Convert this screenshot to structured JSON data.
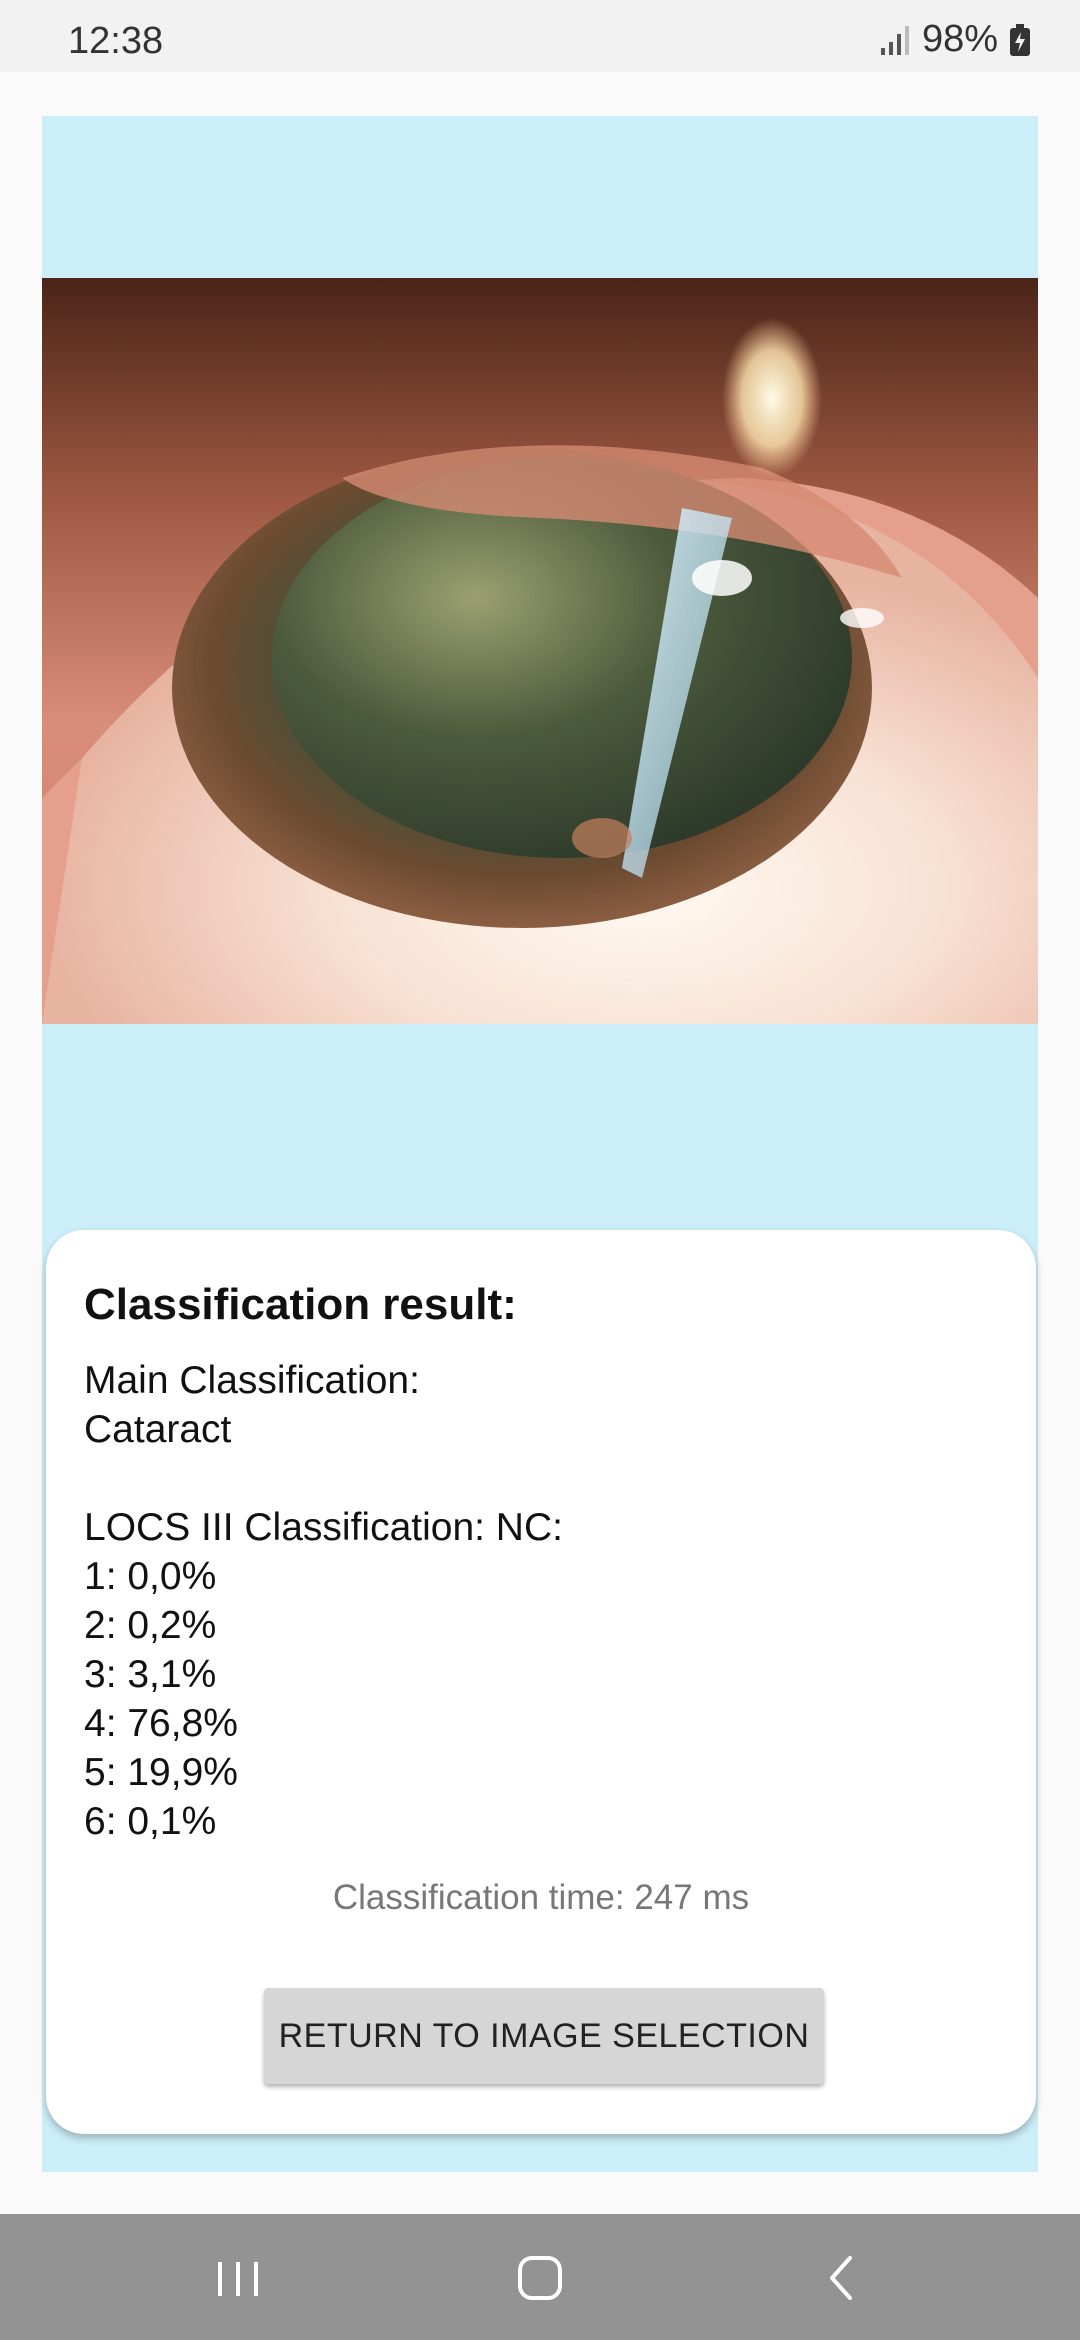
{
  "status_bar": {
    "time": "12:38",
    "battery": "98%",
    "signal_icon": "signal-icon",
    "battery_icon": "battery-charging-icon"
  },
  "colors": {
    "panel_background": "#cbeef8",
    "card_background": "#ffffff",
    "button_background": "#d6d6d6",
    "nav_bar": "#939393"
  },
  "image": {
    "subject": "eye photograph"
  },
  "result": {
    "heading": "Classification result:",
    "main_label": "Main Classification:",
    "main_value": "Cataract",
    "locs_label": "LOCS III Classification: NC:",
    "grades": [
      {
        "text": "1: 0,0%",
        "percent": 0.0
      },
      {
        "text": "2: 0,2%",
        "percent": 0.2
      },
      {
        "text": "3: 3,1%",
        "percent": 3.1
      },
      {
        "text": "4: 76,8%",
        "percent": 76.8
      },
      {
        "text": "5: 19,9%",
        "percent": 19.9
      },
      {
        "text": "6: 0,1%",
        "percent": 0.1
      }
    ],
    "time_text": "Classification time: 247 ms",
    "return_button_label": "RETURN TO IMAGE SELECTION"
  },
  "nav_bar": {
    "recents_icon": "recents-icon",
    "home_icon": "home-icon",
    "back_icon": "back-icon"
  }
}
